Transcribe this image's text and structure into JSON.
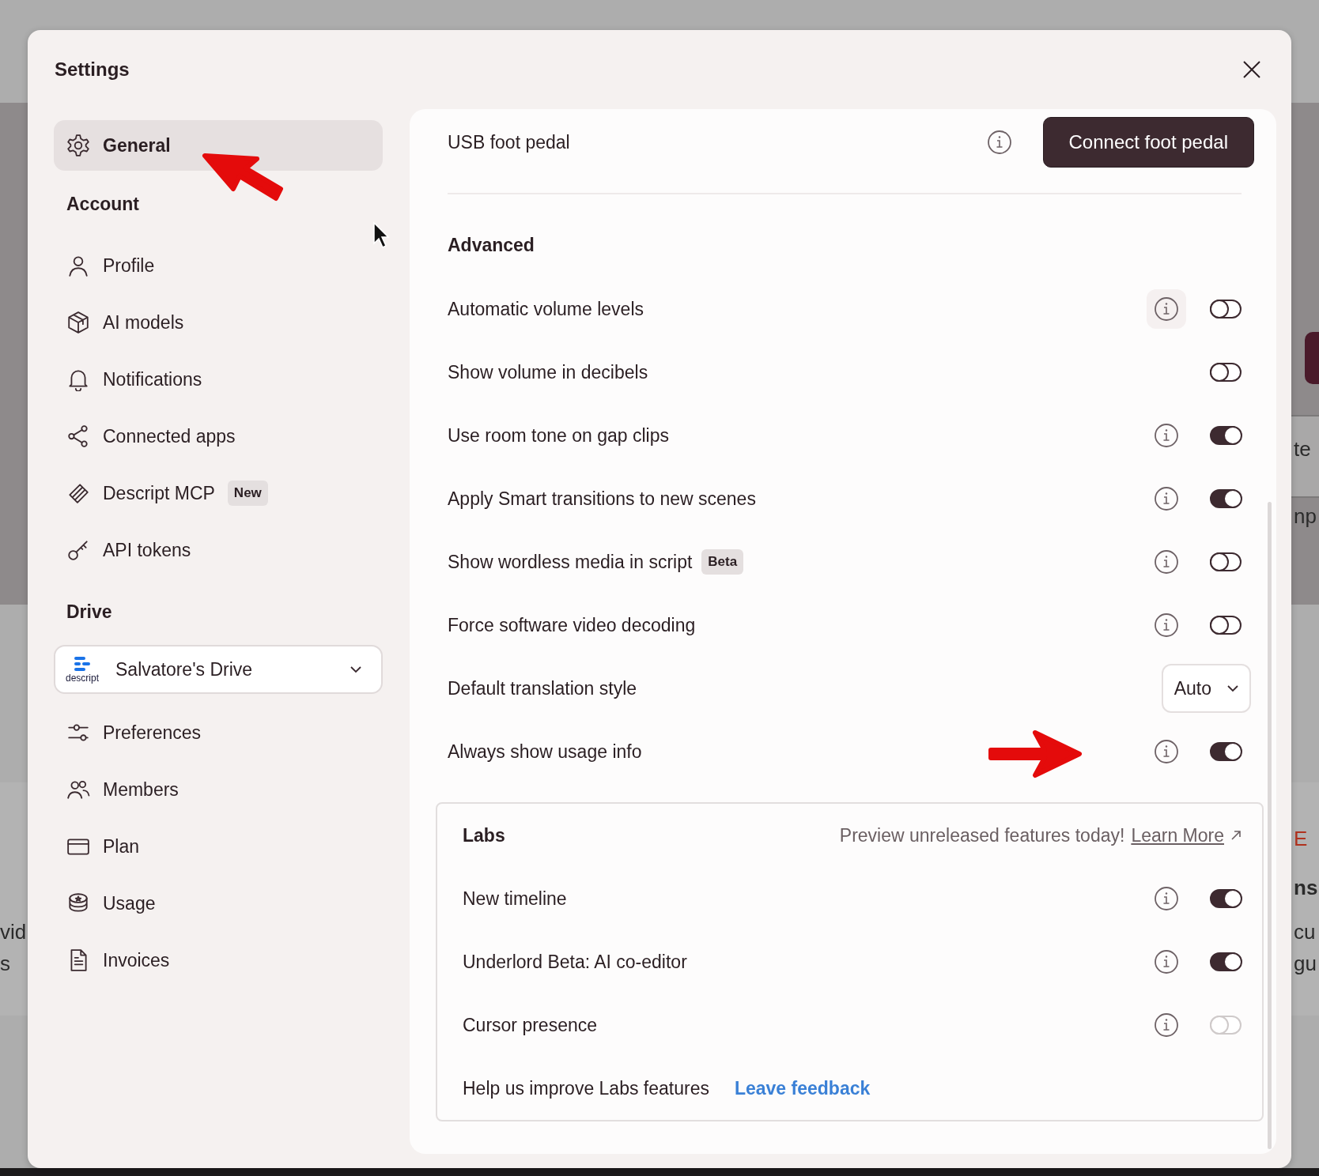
{
  "window": {
    "title": "Settings"
  },
  "sidebar": {
    "items": [
      {
        "kind": "item",
        "label": "General",
        "selected": true
      },
      {
        "kind": "heading",
        "label": "Account"
      },
      {
        "kind": "item",
        "label": "Profile",
        "selected": false
      },
      {
        "kind": "item",
        "label": "AI models",
        "selected": false
      },
      {
        "kind": "item",
        "label": "Notifications",
        "selected": false
      },
      {
        "kind": "item",
        "label": "Connected apps",
        "selected": false
      },
      {
        "kind": "item",
        "label": "Descript MCP",
        "selected": false,
        "badge": "New"
      },
      {
        "kind": "item",
        "label": "API tokens",
        "selected": false
      },
      {
        "kind": "heading",
        "label": "Drive"
      },
      {
        "kind": "drive",
        "label": "Salvatore's Drive",
        "logo_text": "descript"
      },
      {
        "kind": "item",
        "label": "Preferences",
        "selected": false
      },
      {
        "kind": "item",
        "label": "Members",
        "selected": false
      },
      {
        "kind": "item",
        "label": "Plan",
        "selected": false
      },
      {
        "kind": "item",
        "label": "Usage",
        "selected": false
      },
      {
        "kind": "item",
        "label": "Invoices",
        "selected": false
      }
    ]
  },
  "foot_pedal": {
    "label": "USB foot pedal",
    "info": true,
    "button": "Connect foot pedal"
  },
  "advanced": {
    "heading": "Advanced",
    "rows": [
      {
        "kind": "toggle",
        "label": "Automatic volume levels",
        "info": true,
        "info_highlighted": true,
        "on": false
      },
      {
        "kind": "toggle",
        "label": "Show volume in decibels",
        "info": false,
        "on": false
      },
      {
        "kind": "toggle",
        "label": "Use room tone on gap clips",
        "info": true,
        "on": true
      },
      {
        "kind": "toggle",
        "label": "Apply Smart transitions to new scenes",
        "info": true,
        "on": true
      },
      {
        "kind": "toggle",
        "label": "Show wordless media in script",
        "badge": "Beta",
        "info": true,
        "on": false
      },
      {
        "kind": "toggle",
        "label": "Force software video decoding",
        "info": true,
        "on": false
      },
      {
        "kind": "select",
        "label": "Default translation style",
        "value": "Auto"
      },
      {
        "kind": "toggle",
        "label": "Always show usage info",
        "info": true,
        "on": true
      }
    ]
  },
  "labs": {
    "heading": "Labs",
    "tagline": "Preview unreleased features today!",
    "link": "Learn More",
    "rows": [
      {
        "kind": "toggle",
        "label": "New timeline",
        "info": true,
        "on": true,
        "disabled": false
      },
      {
        "kind": "toggle",
        "label": "Underlord Beta: AI co-editor",
        "info": true,
        "on": true,
        "disabled": false
      },
      {
        "kind": "toggle",
        "label": "Cursor presence",
        "info": true,
        "on": false,
        "disabled": true
      },
      {
        "kind": "feedback",
        "label": "Help us improve Labs features",
        "link": "Leave feedback"
      }
    ]
  },
  "backdrop": {
    "fragments": [
      {
        "text": "vid",
        "color": "#2b2b2b"
      },
      {
        "text": "s",
        "color": "#2b2b2b"
      },
      {
        "text": "te",
        "color": "#2b2b2b"
      },
      {
        "text": "np",
        "color": "#2b2b2b"
      },
      {
        "text": "E",
        "color": "#b0321e"
      },
      {
        "text": "ns",
        "color": "#2b2b2b"
      },
      {
        "text": "cu",
        "color": "#2b2b2b"
      },
      {
        "text": "gu",
        "color": "#2b2b2b"
      }
    ]
  }
}
